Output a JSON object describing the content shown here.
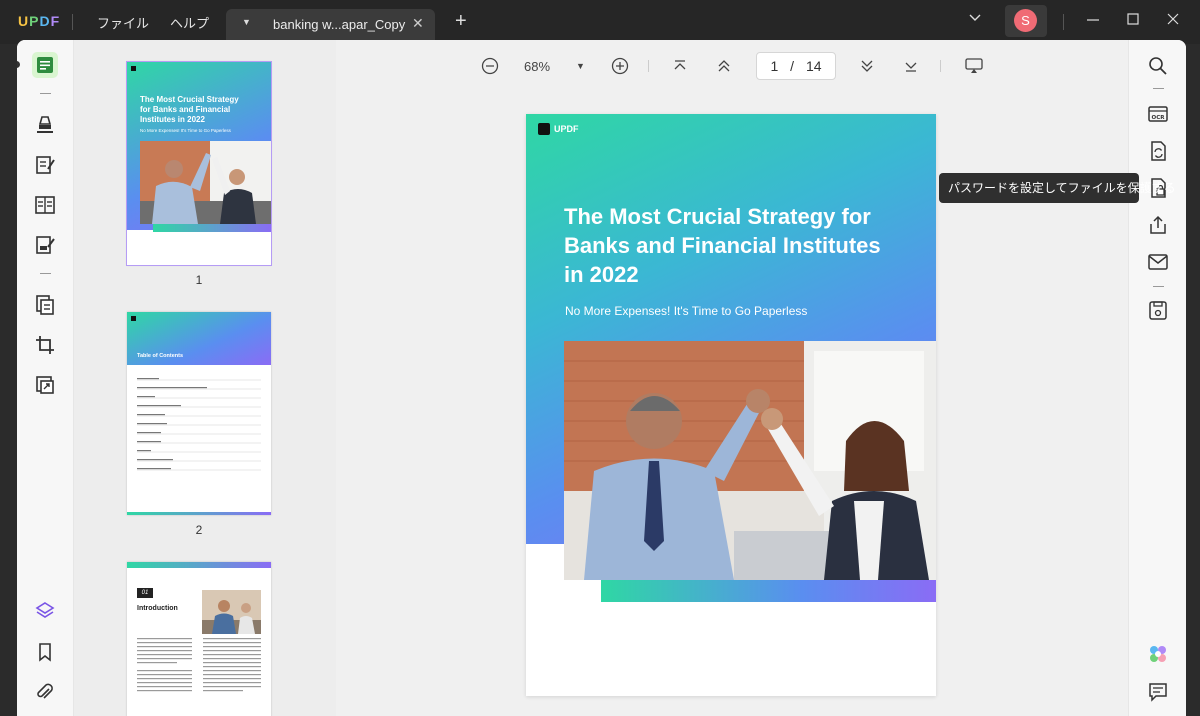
{
  "titlebar": {
    "logo": [
      "U",
      "P",
      "D",
      "F"
    ],
    "logo_colors": [
      "#f6c344",
      "#6fd17a",
      "#5ab7f0",
      "#b08af7"
    ],
    "menu": [
      "ファイル",
      "ヘルプ"
    ],
    "tab_title": "banking w...apar_Copy",
    "avatar_letter": "S"
  },
  "toolbar": {
    "zoom": "68%",
    "page_current": "1",
    "page_sep": "/",
    "page_total": "14"
  },
  "thumbnails": {
    "page1": {
      "title": "The Most Crucial Strategy for Banks and Financial Institutes in 2022",
      "subtitle": "No More Expenses! It's Time to Go Paperless",
      "num": "1"
    },
    "page2": {
      "title": "Table of Contents",
      "num": "2"
    },
    "page3": {
      "chapter": "01",
      "title": "Introduction"
    }
  },
  "page": {
    "logo": "UPDF",
    "title": "The Most Crucial Strategy for Banks and Financial Institutes in 2022",
    "subtitle": "No More Expenses! It's Time to Go Paperless"
  },
  "tooltip": "パスワードを設定してファイルを保護する",
  "colors": {
    "accent_green": "#2fd7a4",
    "accent_purple": "#8a6cf5",
    "avatar": "#f06b75"
  }
}
